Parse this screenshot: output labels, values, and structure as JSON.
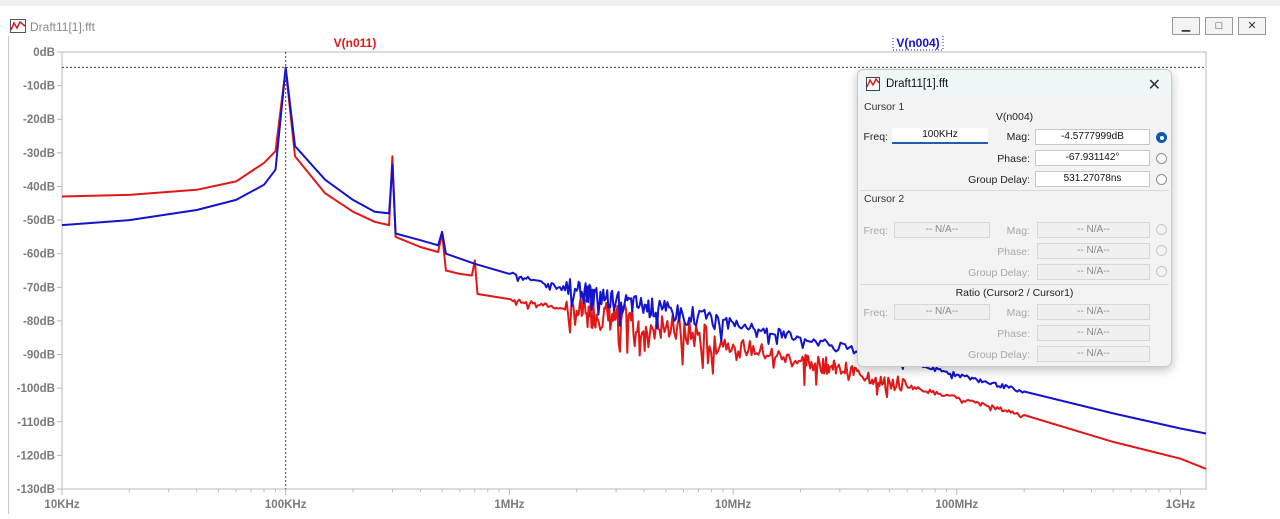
{
  "window": {
    "title": "Draft11[1].fft",
    "minimize": "▁",
    "maximize": "□",
    "close": "✕"
  },
  "trace_labels": {
    "red": "V(n011)",
    "blue": "V(n004)"
  },
  "colors": {
    "trace_red": "#e01818",
    "trace_blue": "#1414cc",
    "grid": "#b8b8b8",
    "axis_text": "#7a7a7a"
  },
  "y_ticks": [
    "0dB",
    "-10dB",
    "-20dB",
    "-30dB",
    "-40dB",
    "-50dB",
    "-60dB",
    "-70dB",
    "-80dB",
    "-90dB",
    "-100dB",
    "-110dB",
    "-120dB",
    "-130dB"
  ],
  "x_ticks": [
    "10KHz",
    "100KHz",
    "1MHz",
    "10MHz",
    "100MHz",
    "1GHz"
  ],
  "chart_data": {
    "type": "line",
    "x_scale": "log",
    "xlim_hz": [
      10000,
      1300000000
    ],
    "ylim_db": [
      -130,
      0
    ],
    "y_ticks_db": [
      0,
      -10,
      -20,
      -30,
      -40,
      -50,
      -60,
      -70,
      -80,
      -90,
      -100,
      -110,
      -120,
      -130
    ],
    "x_ticks_hz": [
      10000,
      100000,
      1000000,
      10000000,
      100000000,
      1000000000
    ],
    "cursor": {
      "x_hz": 100000,
      "y_db": -4.5778
    },
    "series": [
      {
        "name": "V(n011)",
        "color": "#e01818",
        "points": [
          [
            10000,
            -43
          ],
          [
            20000,
            -42.5
          ],
          [
            40000,
            -41
          ],
          [
            60000,
            -38.5
          ],
          [
            80000,
            -33
          ],
          [
            90000,
            -29.5
          ],
          [
            100000,
            -5
          ],
          [
            110000,
            -31
          ],
          [
            150000,
            -42
          ],
          [
            200000,
            -47.5
          ],
          [
            250000,
            -50.5
          ],
          [
            290000,
            -51.5
          ],
          [
            300000,
            -31
          ],
          [
            310000,
            -55
          ],
          [
            400000,
            -58
          ],
          [
            480000,
            -59.5
          ],
          [
            500000,
            -54
          ],
          [
            520000,
            -65
          ],
          [
            600000,
            -66
          ],
          [
            680000,
            -66.5
          ],
          [
            700000,
            -62
          ],
          [
            720000,
            -72
          ],
          [
            1000000,
            -73.5
          ],
          [
            2000000,
            -77
          ],
          [
            3000000,
            -79
          ],
          [
            5000000,
            -82
          ],
          [
            10000000,
            -87
          ],
          [
            20000000,
            -92
          ],
          [
            30000000,
            -94
          ],
          [
            50000000,
            -98
          ],
          [
            100000000,
            -103
          ],
          [
            200000000,
            -108
          ],
          [
            500000000,
            -116
          ],
          [
            1000000000,
            -121
          ],
          [
            1300000000,
            -124
          ]
        ]
      },
      {
        "name": "V(n004)",
        "color": "#1414cc",
        "points": [
          [
            10000,
            -51.5
          ],
          [
            20000,
            -50
          ],
          [
            40000,
            -47
          ],
          [
            60000,
            -44
          ],
          [
            80000,
            -39.5
          ],
          [
            90000,
            -35
          ],
          [
            100000,
            -4.6
          ],
          [
            110000,
            -28
          ],
          [
            150000,
            -38
          ],
          [
            200000,
            -44
          ],
          [
            250000,
            -47.5
          ],
          [
            290000,
            -48
          ],
          [
            300000,
            -33.5
          ],
          [
            310000,
            -54
          ],
          [
            400000,
            -56
          ],
          [
            480000,
            -57.5
          ],
          [
            500000,
            -53.5
          ],
          [
            520000,
            -60
          ],
          [
            700000,
            -63
          ],
          [
            1000000,
            -66
          ],
          [
            2000000,
            -71
          ],
          [
            3000000,
            -74
          ],
          [
            5000000,
            -77
          ],
          [
            10000000,
            -80.5
          ],
          [
            20000000,
            -85
          ],
          [
            50000000,
            -91
          ],
          [
            100000000,
            -96
          ],
          [
            200000000,
            -101
          ],
          [
            500000000,
            -107.5
          ],
          [
            1000000000,
            -112
          ],
          [
            1300000000,
            -113.5
          ]
        ]
      }
    ]
  },
  "dialog": {
    "title": "Draft11[1].fft",
    "close": "✕",
    "cursor1": {
      "section": "Cursor 1",
      "trace": "V(n004)",
      "freq_label": "Freq:",
      "freq_value": "100KHz",
      "mag_label": "Mag:",
      "mag_value": "-4.5777999dB",
      "phase_label": "Phase:",
      "phase_value": "-67.931142°",
      "gd_label": "Group Delay:",
      "gd_value": "531.27078ns"
    },
    "cursor2": {
      "section": "Cursor 2",
      "freq_label": "Freq:",
      "freq_value": "-- N/A--",
      "mag_label": "Mag:",
      "mag_value": "-- N/A--",
      "phase_label": "Phase:",
      "phase_value": "-- N/A--",
      "gd_label": "Group Delay:",
      "gd_value": "-- N/A--"
    },
    "ratio": {
      "section": "Ratio (Cursor2 / Cursor1)",
      "freq_label": "Freq:",
      "freq_value": "-- N/A--",
      "mag_label": "Mag:",
      "mag_value": "-- N/A--",
      "phase_label": "Phase:",
      "phase_value": "-- N/A--",
      "gd_label": "Group Delay:",
      "gd_value": "-- N/A--"
    }
  }
}
